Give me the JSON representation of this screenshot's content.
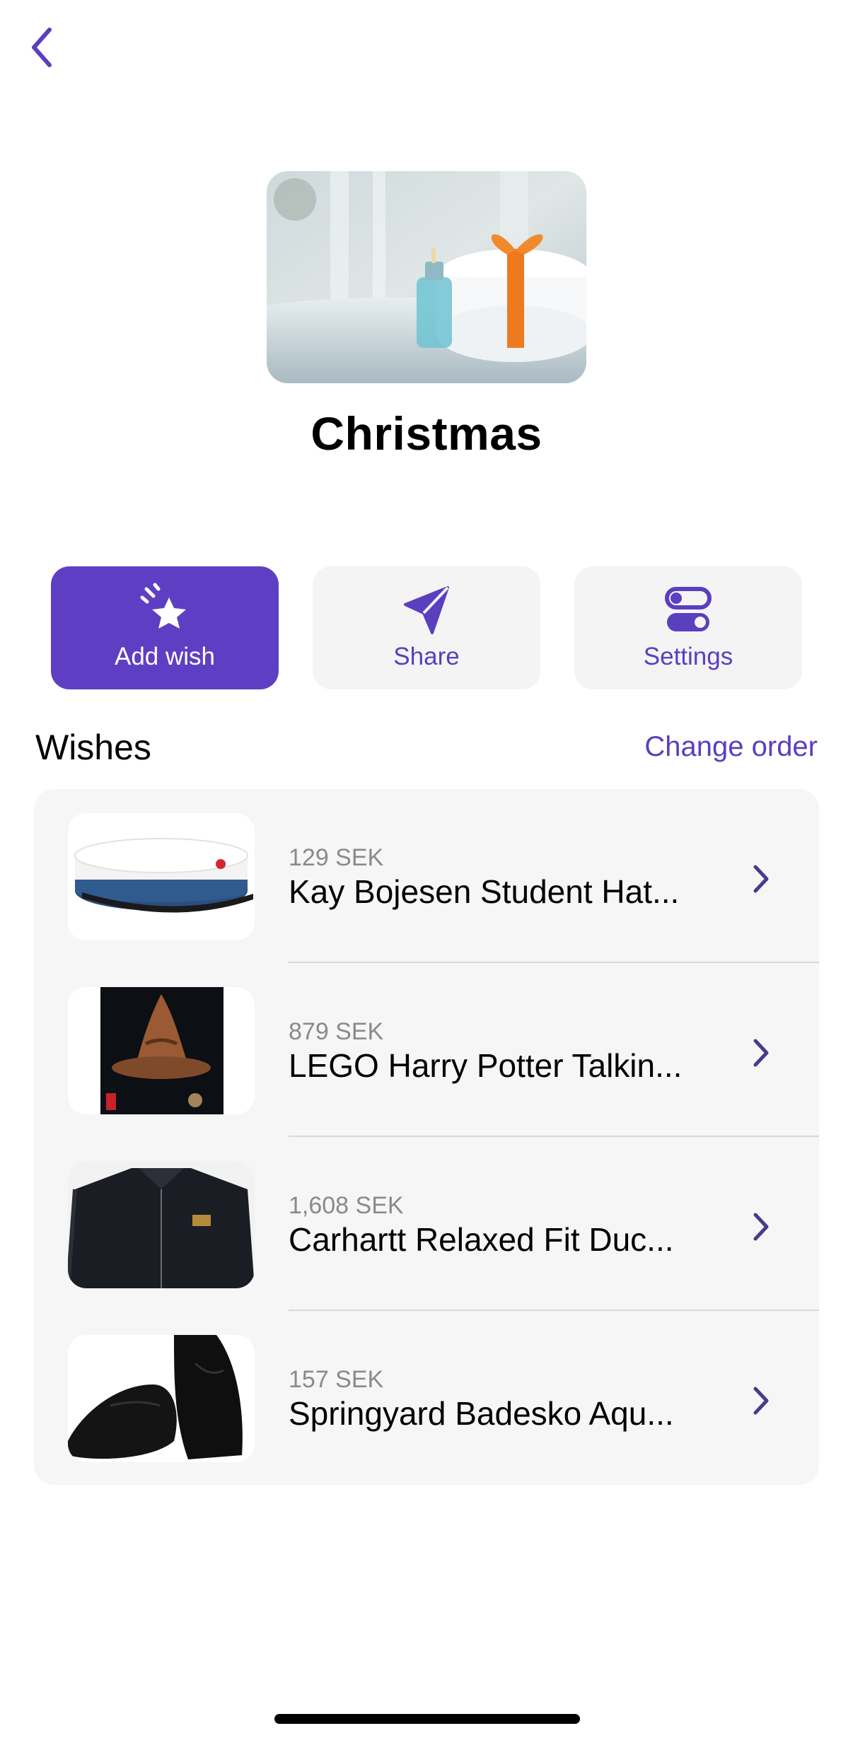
{
  "header": {
    "back_icon": "chevron-left-icon"
  },
  "list_cover": {
    "image": "gift-towels-candle-photo"
  },
  "title": "Christmas",
  "actions": [
    {
      "label": "Add wish",
      "icon": "sparkle-star-icon"
    },
    {
      "label": "Share",
      "icon": "paper-plane-icon"
    },
    {
      "label": "Settings",
      "icon": "toggles-icon"
    }
  ],
  "wishes_section": {
    "title": "Wishes",
    "change_order_label": "Change order"
  },
  "wishes": [
    {
      "price": "129 SEK",
      "name": "Kay Bojesen Student Hat...",
      "image": "student-hat"
    },
    {
      "price": "879 SEK",
      "name": "LEGO Harry Potter Talkin...",
      "image": "lego-sorting-hat"
    },
    {
      "price": "1,608 SEK",
      "name": "Carhartt Relaxed Fit Duc...",
      "image": "black-jacket"
    },
    {
      "price": "157 SEK",
      "name": "Springyard Badesko Aqu...",
      "image": "black-water-shoes"
    }
  ],
  "colors": {
    "accent": "#5e3fc4",
    "accent_text": "#5a3fbf",
    "card_bg": "#f6f6f6",
    "price_gray": "#8a8a8e"
  }
}
